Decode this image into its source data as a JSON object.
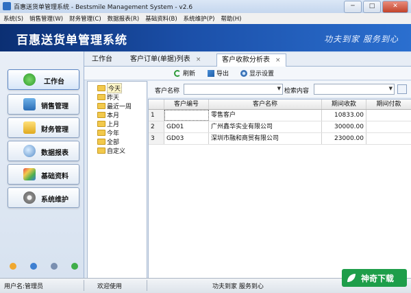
{
  "window": {
    "title": "百惠送货单管理系统 - Bestsmile Management System - v2.6"
  },
  "menu": [
    "系统(S)",
    "销售管理(W)",
    "财务管理(C)",
    "数据报表(R)",
    "基础资料(B)",
    "系统维护(P)",
    "帮助(H)"
  ],
  "banner": {
    "title": "百惠送货单管理系统",
    "slogan": "功夫到家 服务到心"
  },
  "nav": [
    "工作台",
    "销售管理",
    "财务管理",
    "数据报表",
    "基础资料",
    "系统维护"
  ],
  "tabs": [
    {
      "label": "工作台"
    },
    {
      "label": "客户订单(单据)列表",
      "close": "×"
    },
    {
      "label": "客户收款分析表",
      "close": "×"
    }
  ],
  "toolbar": [
    "刷新",
    "导出",
    "显示设置"
  ],
  "tree": [
    "今天",
    "昨天",
    "最近一周",
    "本月",
    "上月",
    "今年",
    "全部",
    "自定义"
  ],
  "filter": {
    "customer_label": "客户名称",
    "search_label": "检索内容"
  },
  "table": {
    "columns": [
      "",
      "客户编号",
      "客户名称",
      "期间收款",
      "期间付款"
    ],
    "rows": [
      [
        "1",
        "",
        "零售客户",
        "10833.00",
        ""
      ],
      [
        "2",
        "GD01",
        "广州鑫华实业有限公司",
        "30000.00",
        ""
      ],
      [
        "3",
        "GD03",
        "深圳市融和商贸有限公司",
        "23000.00",
        ""
      ]
    ]
  },
  "status": {
    "user": "用户名:管理员",
    "welcome": "欢迎使用",
    "motto": "功夫到家 服务到心"
  },
  "watermark": "神奇下载",
  "colors": {
    "banner": "#1b4fa8",
    "watermark": "#1e9e4a"
  }
}
